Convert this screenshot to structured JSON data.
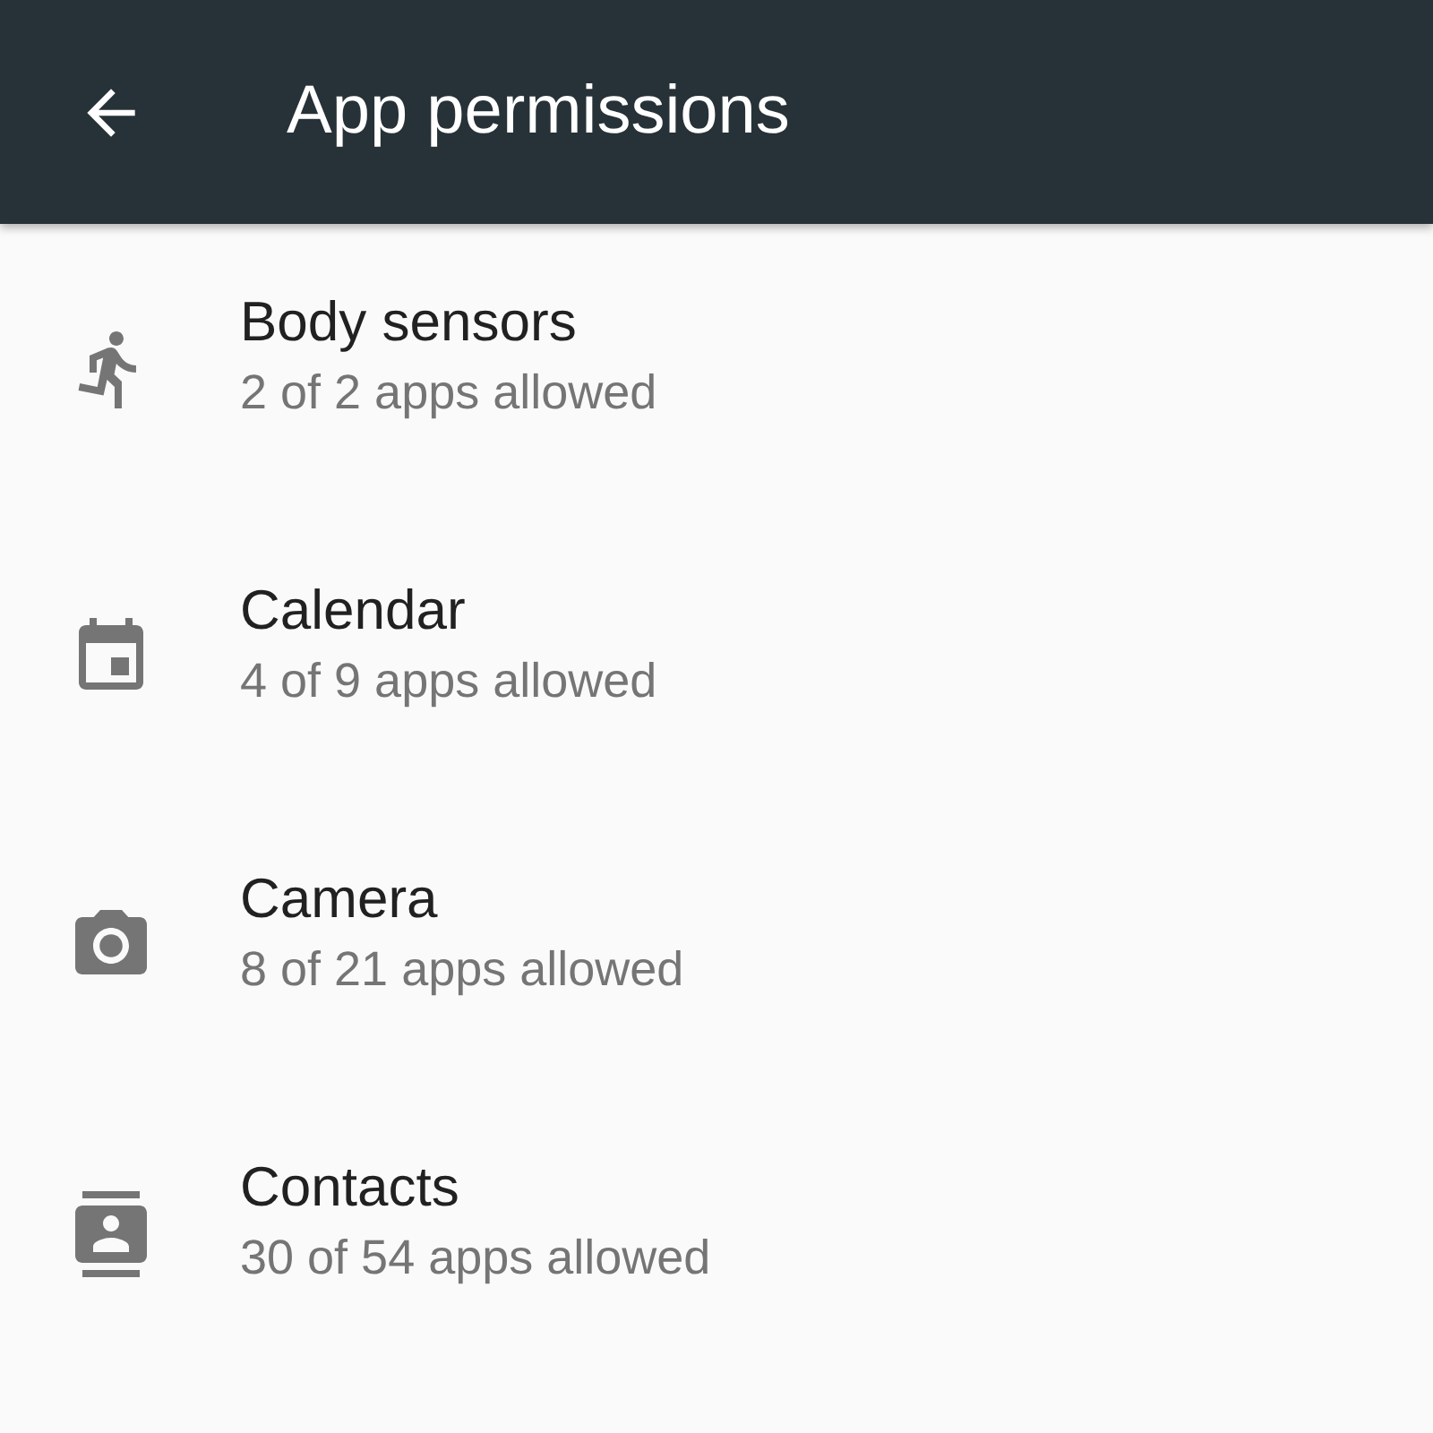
{
  "app_bar": {
    "title": "App permissions"
  },
  "permissions": [
    {
      "kind": "sensors",
      "name": "Body sensors",
      "summary": "2 of 2 apps allowed"
    },
    {
      "kind": "calendar",
      "name": "Calendar",
      "summary": "4 of 9 apps allowed"
    },
    {
      "kind": "camera",
      "name": "Camera",
      "summary": "8 of 21 apps allowed"
    },
    {
      "kind": "contacts",
      "name": "Contacts",
      "summary": "30 of 54 apps allowed"
    }
  ]
}
